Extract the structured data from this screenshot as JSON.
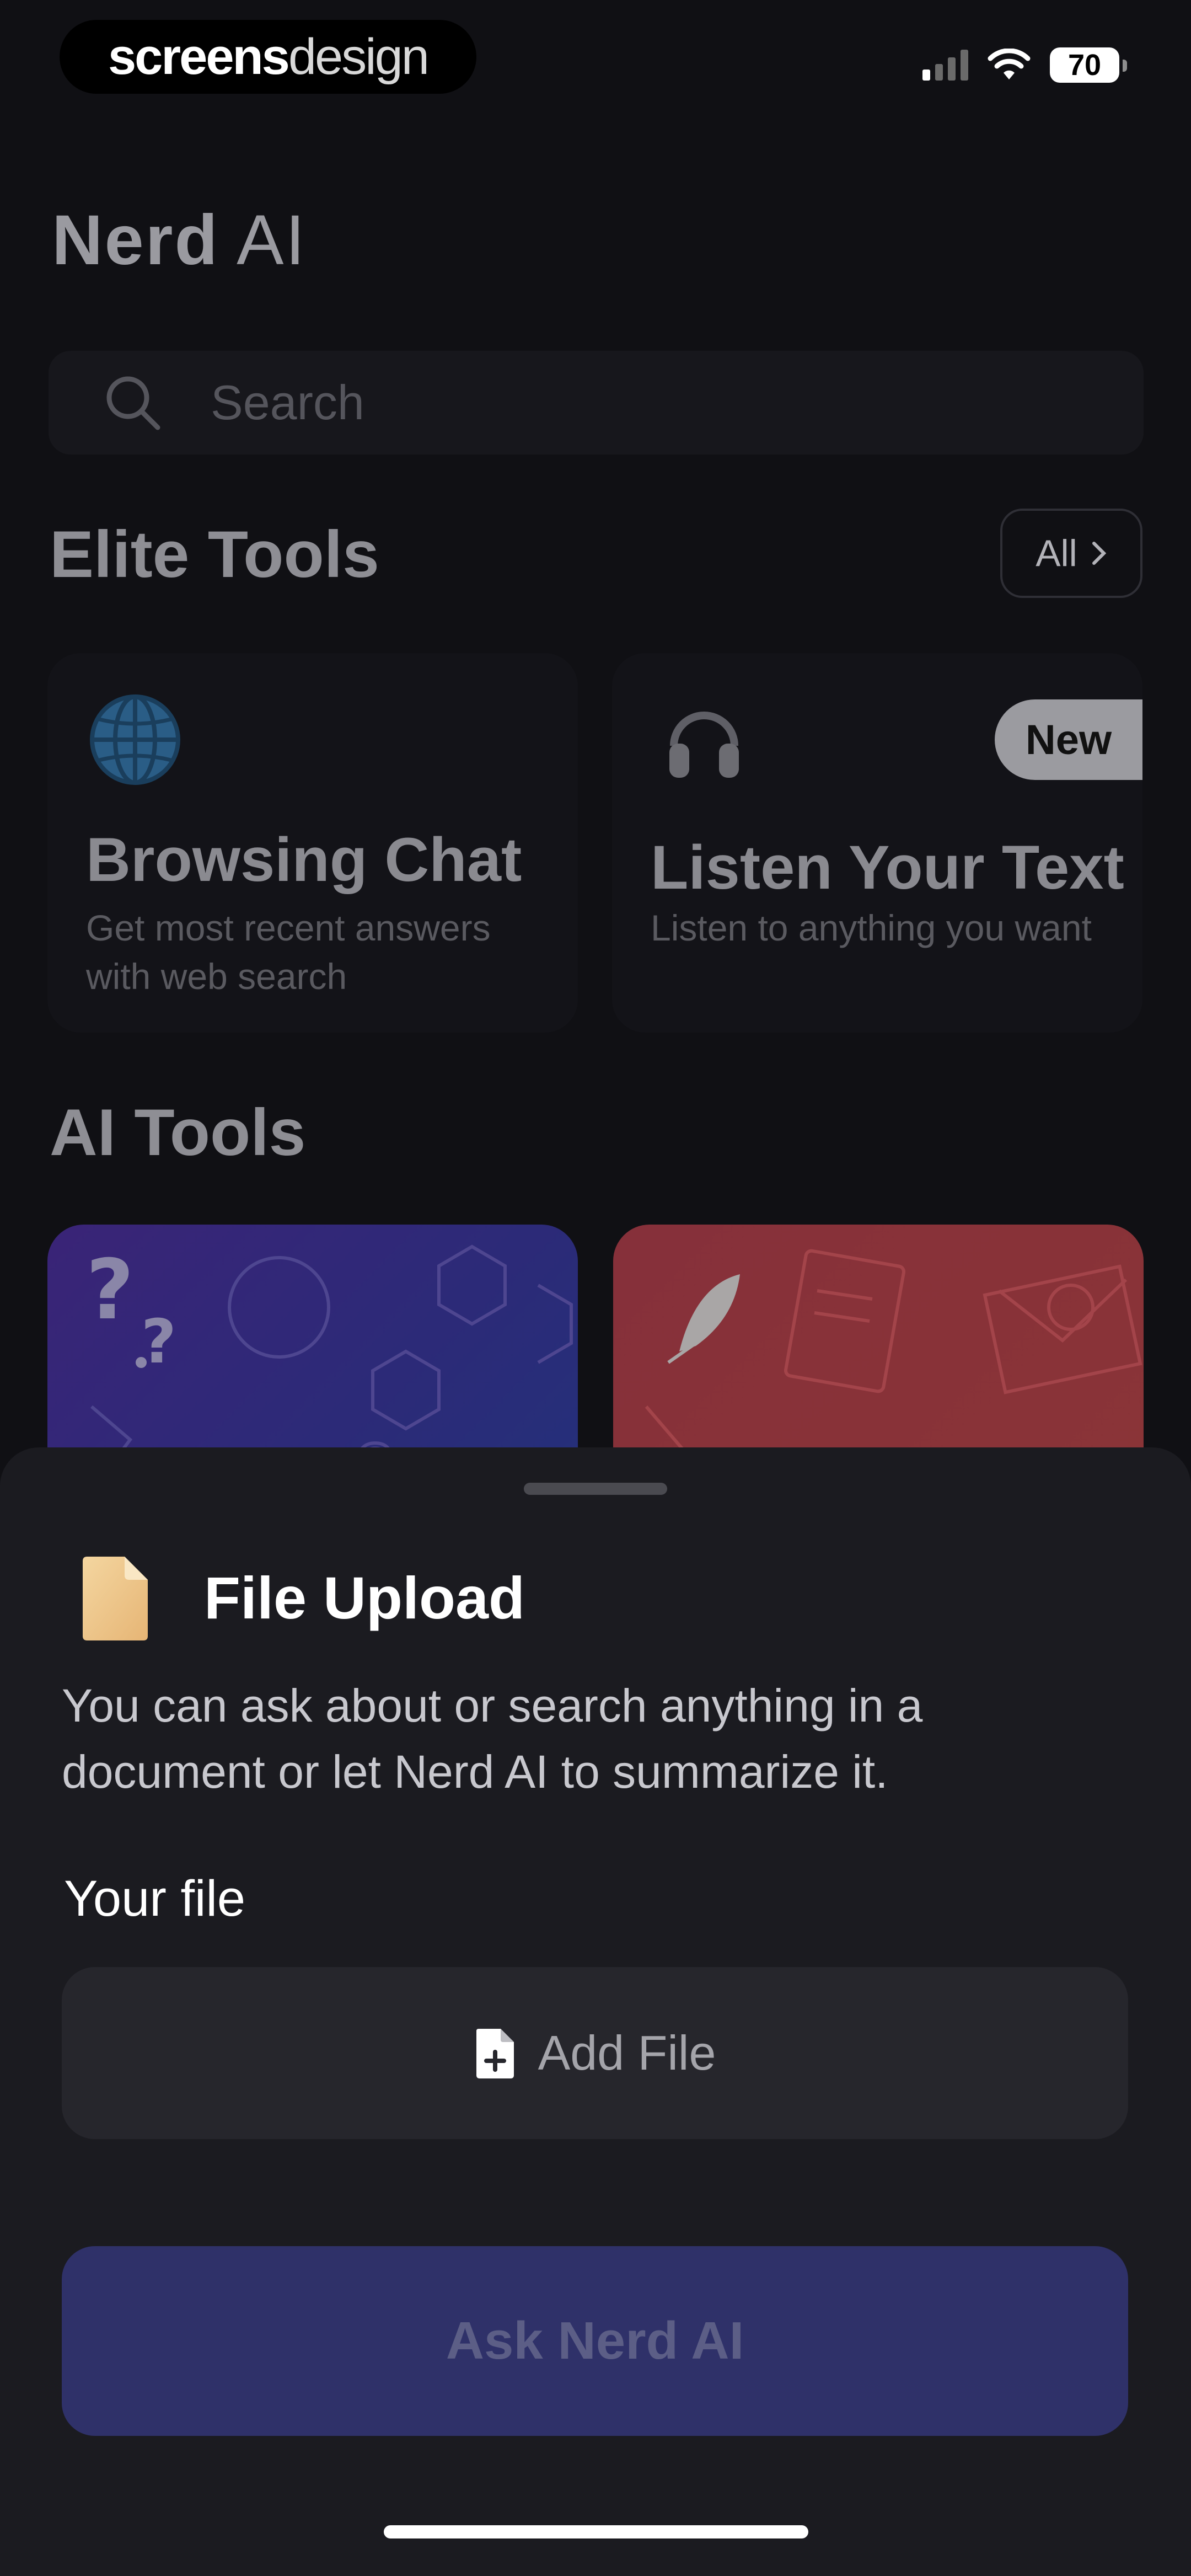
{
  "status_bar": {
    "brand_part1": "screens",
    "brand_part2": "design",
    "battery": "70",
    "icons": [
      "signal-icon",
      "wifi-icon",
      "battery-icon"
    ]
  },
  "app": {
    "title_bold": "Nerd",
    "title_light": "AI"
  },
  "search": {
    "placeholder": "Search",
    "icon": "search-icon"
  },
  "elite_tools": {
    "heading": "Elite Tools",
    "all_label": "All",
    "cards": [
      {
        "title": "Browsing Chat",
        "description": "Get most recent answers with web search",
        "icon": "globe-icon"
      },
      {
        "title": "Listen Your Text",
        "description": "Listen to anything you want",
        "icon": "headphones-icon",
        "badge": "New"
      }
    ]
  },
  "ai_tools": {
    "heading": "AI Tools",
    "cards": [
      {
        "icon": "question-marks-icon",
        "color": "#3a2a8a"
      },
      {
        "icon": "feather-icon",
        "color": "#8a2f34"
      }
    ]
  },
  "sheet": {
    "icon": "document-icon",
    "title": "File Upload",
    "description": "You can ask about or search anything in a document or let Nerd AI to summarize it.",
    "file_label": "Your file",
    "add_file_label": "Add File",
    "submit_label": "Ask Nerd AI"
  },
  "colors": {
    "background": "#101014",
    "sheet": "#1b1b20",
    "accent_button": "#2f3169"
  }
}
